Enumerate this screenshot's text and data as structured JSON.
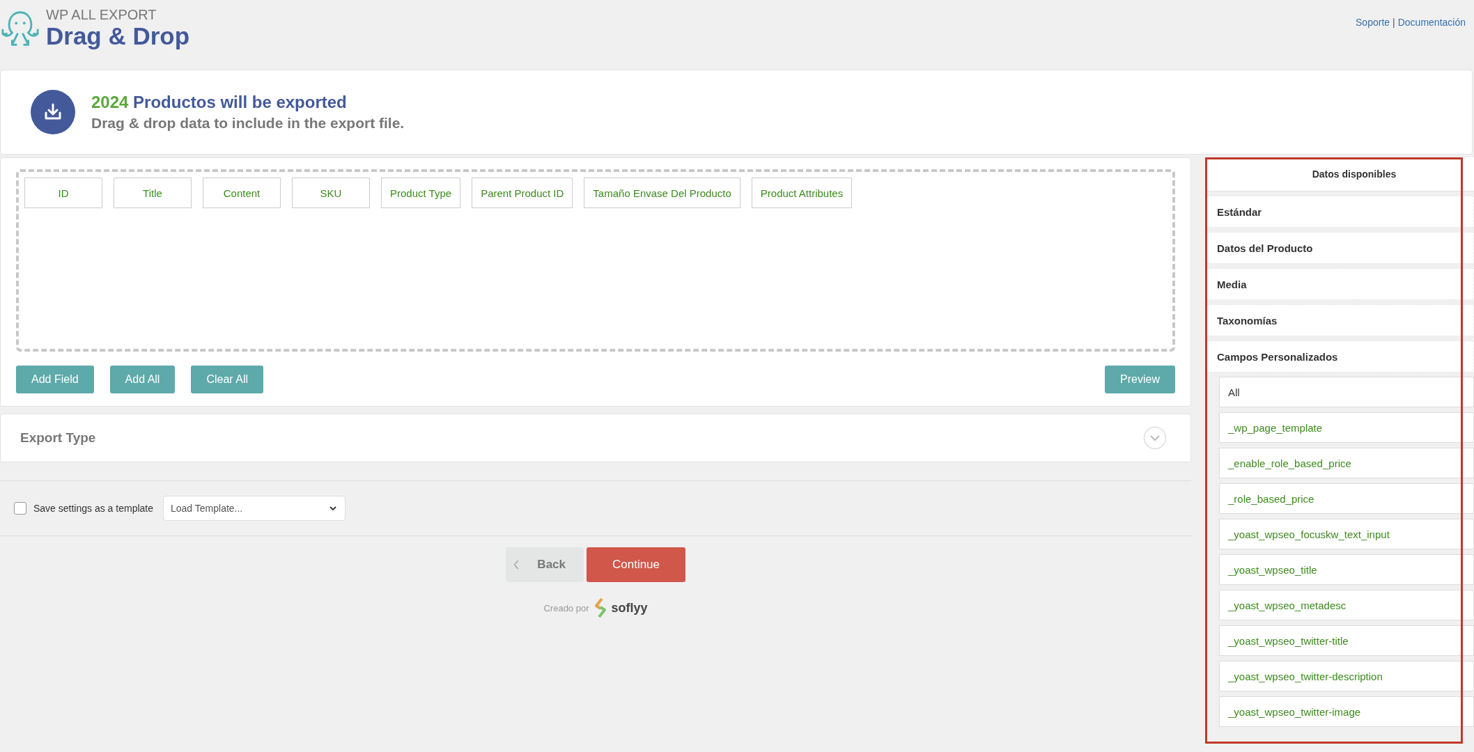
{
  "header": {
    "product": "WP ALL EXPORT",
    "title": "Drag & Drop",
    "links": [
      "Soporte",
      "Documentación"
    ],
    "separator": "|"
  },
  "summary": {
    "count": "2024",
    "headline": "Productos will be exported",
    "subtitle": "Drag & drop data to include in the export file."
  },
  "selected_fields": [
    "ID",
    "Title",
    "Content",
    "SKU",
    "Product Type",
    "Parent Product ID",
    "Tamaño Envase Del Producto",
    "Product Attributes"
  ],
  "field_buttons": [
    "Add Field",
    "Add All",
    "Clear All"
  ],
  "preview_button": "Preview",
  "export_type": {
    "label": "Export Type",
    "expanded": false
  },
  "template": {
    "checkbox_label": "Save settings as a template",
    "checked": false,
    "select_placeholder": "Load Template..."
  },
  "nav": {
    "back": "Back",
    "continue": "Continue"
  },
  "footer": {
    "credit": "Creado por",
    "brand": "soflyy"
  },
  "sidebar": {
    "title": "Datos disponibles",
    "highlighted": true,
    "sections": [
      {
        "label": "Estándar"
      },
      {
        "label": "Datos del Producto"
      },
      {
        "label": "Media"
      },
      {
        "label": "Taxonomías"
      },
      {
        "label": "Campos Personalizados",
        "fields": [
          {
            "label": "All",
            "kind": "all"
          },
          {
            "label": "_wp_page_template",
            "kind": "field"
          },
          {
            "label": "_enable_role_based_price",
            "kind": "field"
          },
          {
            "label": "_role_based_price",
            "kind": "field"
          },
          {
            "label": "_yoast_wpseo_focuskw_text_input",
            "kind": "field"
          },
          {
            "label": "_yoast_wpseo_title",
            "kind": "field"
          },
          {
            "label": "_yoast_wpseo_metadesc",
            "kind": "field"
          },
          {
            "label": "_yoast_wpseo_twitter-title",
            "kind": "field"
          },
          {
            "label": "_yoast_wpseo_twitter-description",
            "kind": "field"
          },
          {
            "label": "_yoast_wpseo_twitter-image",
            "kind": "field"
          }
        ]
      }
    ]
  }
}
